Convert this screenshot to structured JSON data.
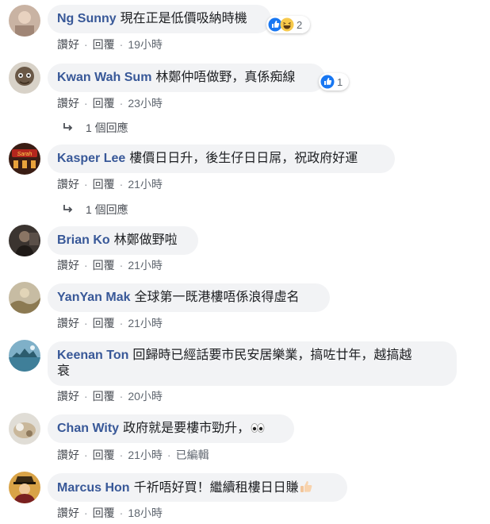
{
  "actions": {
    "like": "讚好",
    "reply": "回覆",
    "edited": "已編輯"
  },
  "comments": [
    {
      "author": "Ng Sunny",
      "text": "現在正是低價吸納時機",
      "time": "19小時",
      "reaction_count": "2"
    },
    {
      "author": "Kwan Wah Sum",
      "text": "林鄭仲唔做野，真係痴線",
      "time": "23小時",
      "reaction_count": "1",
      "replies": "1 個回應"
    },
    {
      "author": "Kasper Lee",
      "text": "樓價日日升，後生仔日日屌，祝政府好運",
      "time": "21小時",
      "replies": "1 個回應",
      "avatar_sign": "Sarah"
    },
    {
      "author": "Brian Ko",
      "text": "林鄭做野啦",
      "time": "21小時"
    },
    {
      "author": "YanYan Mak",
      "text": "全球第一既港樓唔係浪得虛名",
      "time": "21小時"
    },
    {
      "author": "Keenan Ton",
      "text_line1": "回歸時已經話要市民安居樂業，搞咗廿年，越搞越",
      "text_line2": "衰",
      "time": "20小時"
    },
    {
      "author": "Chan Wity",
      "text": "政府就是要樓市勁升，",
      "time": "21小時"
    },
    {
      "author": "Marcus Hon",
      "text": "千祈唔好買！繼續租樓日日賺",
      "time": "18小時"
    }
  ],
  "colors": {
    "author": "#385898",
    "bubble": "#f2f3f5",
    "meta": "#606770",
    "like_blue": "#1877f2"
  },
  "icons": [
    "like-reaction-icon",
    "haha-reaction-icon",
    "reply-arrow-icon",
    "eyes-emoji-icon",
    "thumbs-up-emoji-icon"
  ]
}
